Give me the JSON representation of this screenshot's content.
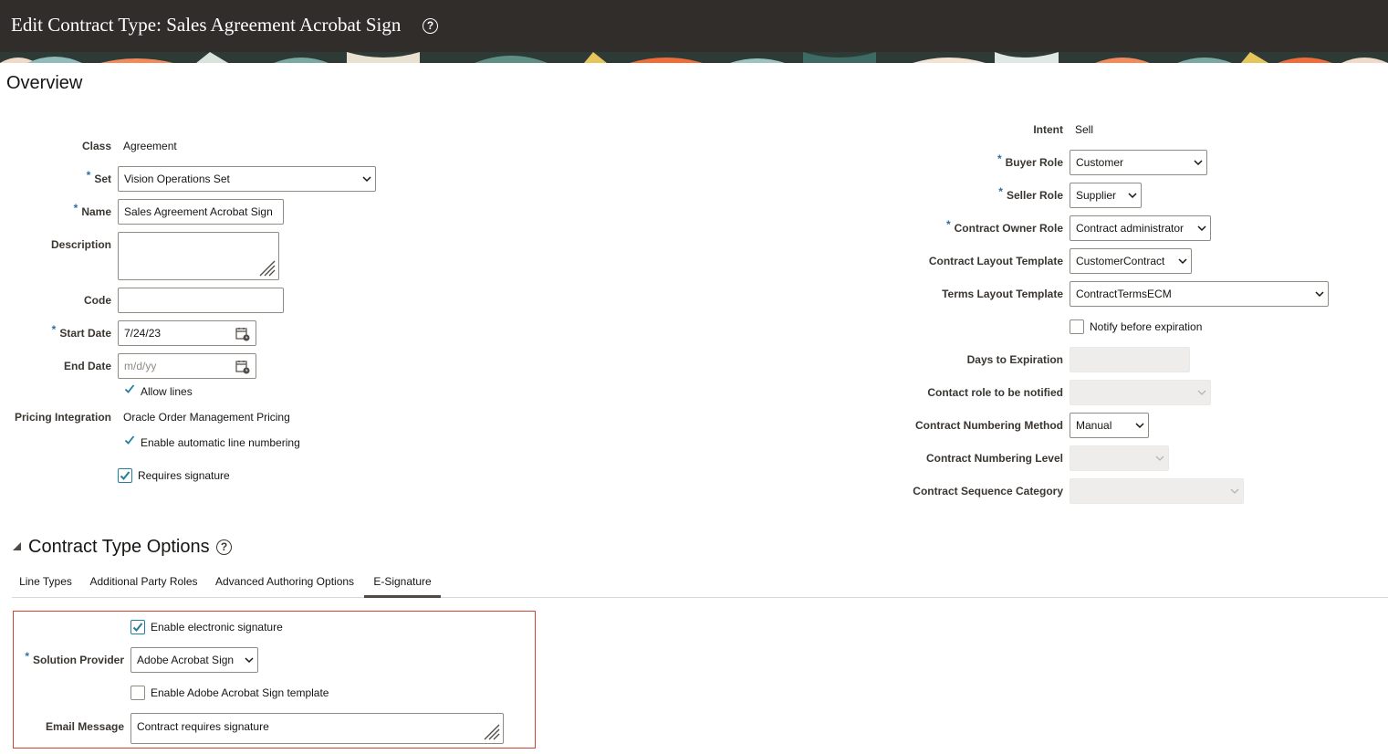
{
  "page": {
    "title": "Edit Contract Type: Sales Agreement Acrobat Sign",
    "overview_heading": "Overview"
  },
  "left_form": {
    "class_label": "Class",
    "class_value": "Agreement",
    "set_label": "Set",
    "set_value": "Vision Operations Set",
    "name_label": "Name",
    "name_value": "Sales Agreement Acrobat Sign",
    "description_label": "Description",
    "description_value": "",
    "code_label": "Code",
    "code_value": "",
    "start_date_label": "Start Date",
    "start_date_value": "7/24/23",
    "end_date_label": "End Date",
    "end_date_placeholder": "m/d/yy",
    "allow_lines_label": "Allow lines",
    "allow_lines": true,
    "pricing_integration_label": "Pricing Integration",
    "pricing_integration_value": "Oracle Order Management Pricing",
    "auto_line_numbering_label": "Enable automatic line numbering",
    "auto_line_numbering": true,
    "requires_signature_label": "Requires signature",
    "requires_signature": true
  },
  "right_form": {
    "intent_label": "Intent",
    "intent_value": "Sell",
    "buyer_role_label": "Buyer Role",
    "buyer_role_value": "Customer",
    "seller_role_label": "Seller Role",
    "seller_role_value": "Supplier",
    "owner_role_label": "Contract Owner Role",
    "owner_role_value": "Contract administrator",
    "layout_template_label": "Contract Layout Template",
    "layout_template_value": "CustomerContract",
    "terms_template_label": "Terms Layout Template",
    "terms_template_value": "ContractTermsECM",
    "notify_label": "Notify before expiration",
    "notify": false,
    "days_label": "Days to Expiration",
    "contact_role_label": "Contact role to be notified",
    "numbering_method_label": "Contract Numbering Method",
    "numbering_method_value": "Manual",
    "numbering_level_label": "Contract Numbering Level",
    "sequence_category_label": "Contract Sequence Category"
  },
  "options": {
    "title": "Contract Type Options",
    "tabs": [
      {
        "label": "Line Types"
      },
      {
        "label": "Additional Party Roles"
      },
      {
        "label": "Advanced Authoring Options"
      },
      {
        "label": "E-Signature"
      }
    ],
    "active_tab": "E-Signature"
  },
  "esignature": {
    "enable_label": "Enable electronic signature",
    "enable": true,
    "provider_label": "Solution Provider",
    "provider_value": "Adobe Acrobat Sign",
    "template_label": "Enable Adobe Acrobat Sign template",
    "template": false,
    "email_label": "Email Message",
    "email_value": "Contract requires signature"
  },
  "colors": {
    "title_bar": "#312d2a",
    "required_marker": "#2d6ea3",
    "checkbox_accent": "#227e9e",
    "highlight_border": "#c74634",
    "active_tab_underline": "#4f4a45"
  },
  "icons": [
    "help-icon",
    "chevron-down-icon",
    "calendar-icon",
    "checkmark-icon",
    "collapse-triangle-icon",
    "resize-grip-icon"
  ]
}
